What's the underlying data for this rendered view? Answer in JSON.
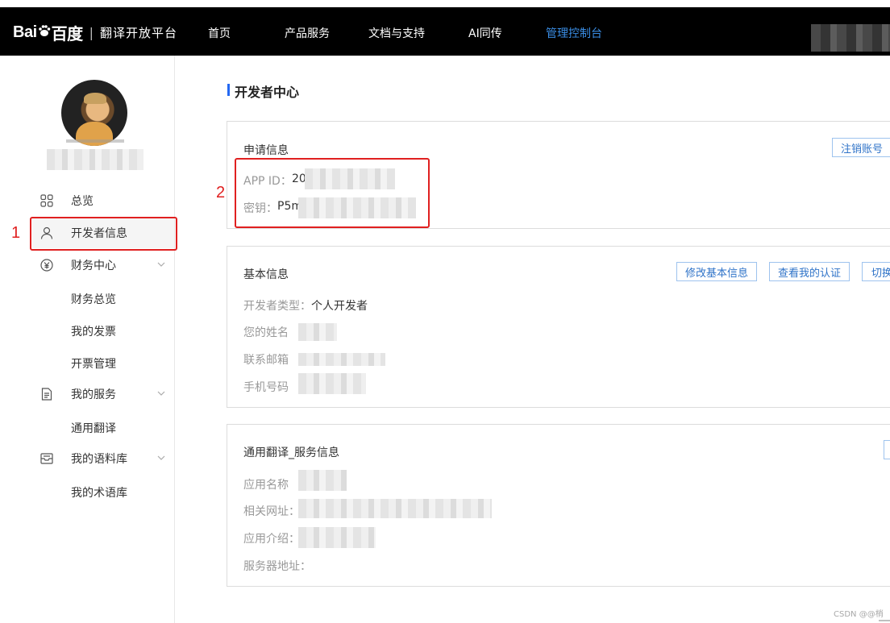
{
  "navbar": {
    "logo_baidu_left": "Bai",
    "logo_baidu_right": "百度",
    "logo_separator": "|",
    "logo_subtitle": "翻译开放平台",
    "items": [
      {
        "label": "首页"
      },
      {
        "label": "产品服务"
      },
      {
        "label": "文档与支持"
      },
      {
        "label": "AI同传"
      },
      {
        "label": "管理控制台"
      }
    ],
    "active_color": "#3a8ee6"
  },
  "sidebar": {
    "menu": [
      {
        "label": "总览",
        "icon": "grid-icon"
      },
      {
        "label": "开发者信息",
        "icon": "user-icon"
      },
      {
        "label": "财务中心",
        "icon": "yen-icon"
      },
      {
        "label": "我的服务",
        "icon": "document-icon"
      },
      {
        "label": "我的语料库",
        "icon": "inbox-icon"
      }
    ],
    "sub_items": {
      "finance": [
        "财务总览",
        "我的发票",
        "开票管理"
      ],
      "service": [
        "通用翻译"
      ],
      "corpus": [
        "我的术语库"
      ]
    }
  },
  "annotations": {
    "num1": "1",
    "num2": "2",
    "color": "#e02020"
  },
  "main": {
    "title": "开发者中心",
    "apply_info": {
      "title": "申请信息",
      "app_id_label": "APP ID：",
      "app_id_value": "20",
      "secret_label": "密钥：",
      "secret_value": "P5m",
      "cancel_button": "注销账号"
    },
    "basic_info": {
      "title": "基本信息",
      "edit_button": "修改基本信息",
      "cert_button": "查看我的认证",
      "switch_button": "切换",
      "type_label": "开发者类型：",
      "type_value": "个人开发者",
      "name_label": "您的姓名",
      "email_label": "联系邮箱",
      "phone_label": "手机号码"
    },
    "service_info": {
      "title": "通用翻译_服务信息",
      "app_name_label": "应用名称",
      "url_label": "相关网址：",
      "intro_label": "应用介绍：",
      "server_label": "服务器地址："
    }
  },
  "watermark": "CSDN @@梢"
}
